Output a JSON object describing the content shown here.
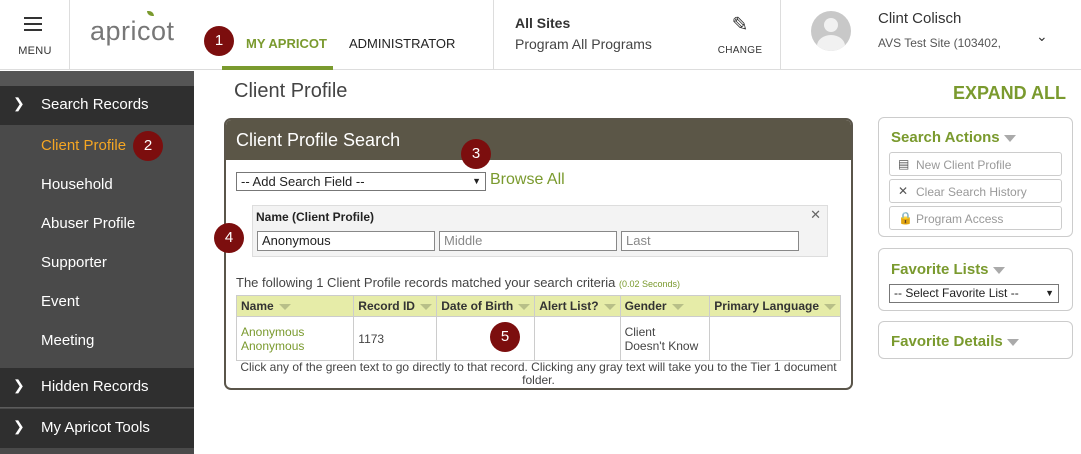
{
  "header": {
    "menu_label": "MENU",
    "logo_text": "apricot",
    "tabs": [
      {
        "label": "MY APRICOT",
        "active": true
      },
      {
        "label": "ADMINISTRATOR",
        "active": false
      }
    ],
    "sites_title": "All Sites",
    "sites_subtitle": "Program All Programs",
    "change_label": "CHANGE",
    "user_name": "Clint Colisch",
    "user_site": "AVS Test Site (103402,"
  },
  "sidebar": {
    "search_records": "Search Records",
    "items": [
      "Client Profile",
      "Household",
      "Abuser Profile",
      "Supporter",
      "Event",
      "Meeting"
    ],
    "active_item": "Client Profile",
    "hidden_records": "Hidden Records",
    "my_apricot_tools": "My Apricot Tools"
  },
  "main": {
    "page_title": "Client Profile",
    "expand_all": "EXPAND ALL"
  },
  "search_panel": {
    "title": "Client Profile Search",
    "add_field_value": "-- Add Search Field --",
    "browse_all": "Browse All",
    "name_label": "Name (Client Profile)",
    "first_value": "Anonymous",
    "middle_placeholder": "Middle",
    "last_placeholder": "Last",
    "result_text": "The following 1 Client Profile records matched your search criteria",
    "result_time": "(0.02 Seconds)",
    "columns": [
      "Name",
      "Record ID",
      "Date of Birth",
      "Alert List?",
      "Gender",
      "Primary Language"
    ],
    "rows": [
      {
        "name_line1": "Anonymous",
        "name_line2": "Anonymous",
        "record_id": "1173",
        "dob": "",
        "alert": "",
        "gender_line1": "Client",
        "gender_line2": "Doesn't Know",
        "language": ""
      }
    ],
    "footer_note": "Click any of the green text to go directly to that record. Clicking any gray text will take you to the Tier 1 document folder."
  },
  "right_panel": {
    "search_actions_title": "Search Actions",
    "actions": [
      {
        "label": "New Client Profile",
        "icon": "new-doc-icon"
      },
      {
        "label": "Clear Search History",
        "icon": "close-icon"
      },
      {
        "label": "Program Access",
        "icon": "lock-icon"
      }
    ],
    "favorite_lists_title": "Favorite Lists",
    "favorite_select_value": "-- Select Favorite List --",
    "favorite_details_title": "Favorite Details"
  },
  "markers": [
    "1",
    "2",
    "3",
    "4",
    "5"
  ],
  "colors": {
    "accent_green": "#7a9a2e",
    "panel_header": "#5b5647",
    "sidebar_bg": "#4a4a4a",
    "sidebar_group_bg": "#2f2f2f",
    "active_orange": "#f5a623",
    "marker_red": "#7c0e0e"
  }
}
